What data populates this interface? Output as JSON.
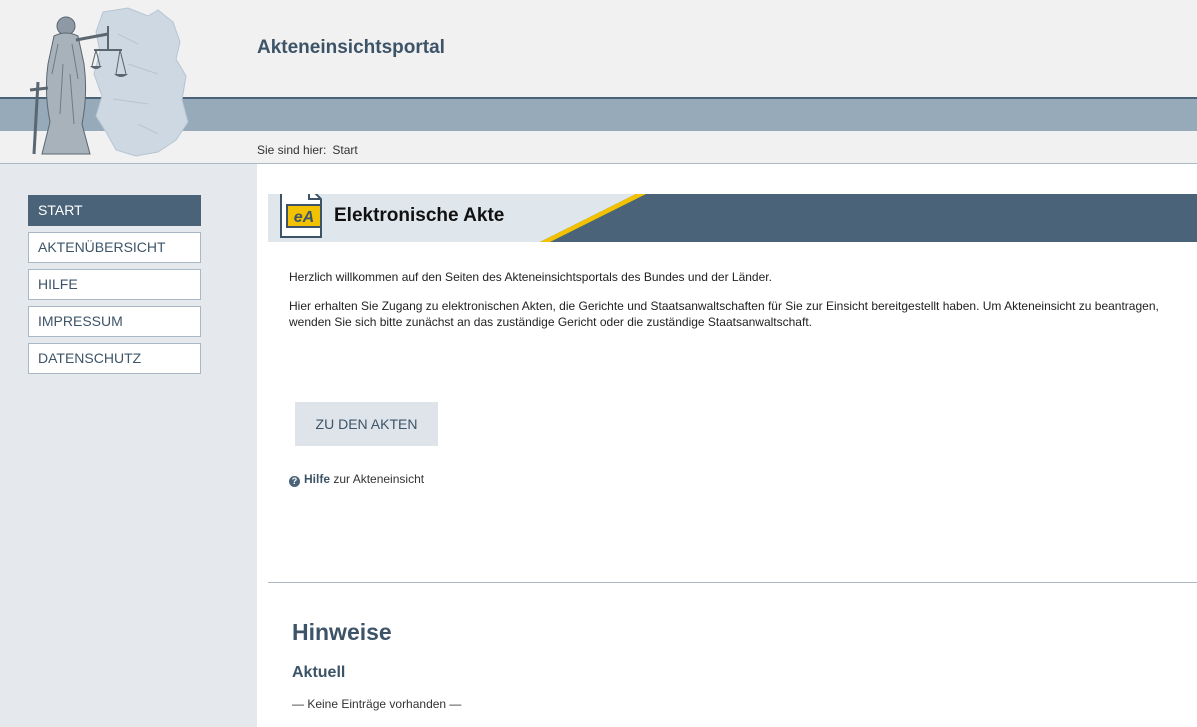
{
  "header": {
    "title": "Akteneinsichtsportal",
    "breadcrumb_prefix": "Sie sind hier:",
    "breadcrumb_current": "Start"
  },
  "sidebar": {
    "items": [
      {
        "label": "START",
        "active": true
      },
      {
        "label": "AKTENÜBERSICHT",
        "active": false
      },
      {
        "label": "HILFE",
        "active": false
      },
      {
        "label": "IMPRESSUM",
        "active": false
      },
      {
        "label": "DATENSCHUTZ",
        "active": false
      }
    ]
  },
  "main": {
    "panel_icon_text": "eA",
    "panel_title": "Elektronische Akte",
    "intro_welcome": "Herzlich willkommen auf den Seiten des Akteneinsichtsportals des Bundes und der Länder.",
    "intro_body": "Hier erhalten Sie Zugang zu elektronischen Akten, die Gerichte und Staatsanwaltschaften für Sie zur Einsicht bereitgestellt haben. Um Akteneinsicht zu beantragen, wenden Sie sich bitte zunächst an das zuständige Gericht oder die zuständige Staatsanwaltschaft.",
    "cta_label": "ZU DEN AKTEN",
    "help_bold": "Hilfe",
    "help_rest": "zur Akteneinsicht",
    "notes_title": "Hinweise",
    "notes_subtitle": "Aktuell",
    "notes_empty": "— Keine Einträge vorhanden —"
  },
  "colors": {
    "primary": "#4a6378",
    "band": "#96aab9",
    "accent_yellow": "#f2c200",
    "sidebar_bg": "#e5e9ed"
  },
  "icons": {
    "logo": "justitia-germany-logo",
    "panel": "electronic-file-icon",
    "help": "question-circle-icon"
  }
}
